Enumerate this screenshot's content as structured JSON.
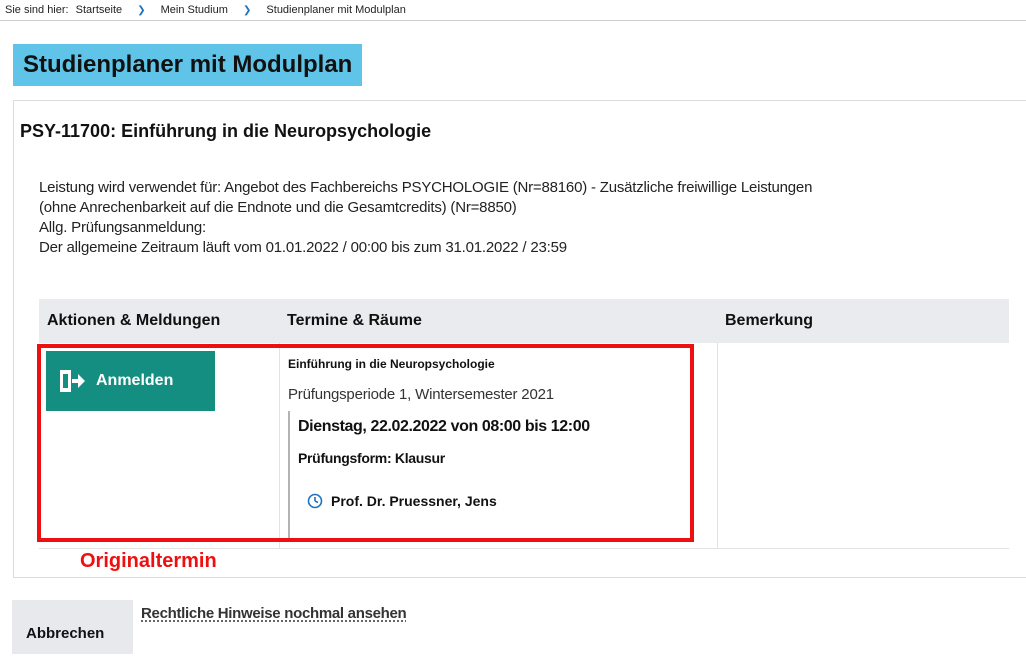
{
  "breadcrumb": {
    "prefix": "Sie sind hier:",
    "items": [
      "Startseite",
      "Mein Studium",
      "Studienplaner mit Modulplan"
    ]
  },
  "page": {
    "title": "Studienplaner mit Modulplan"
  },
  "module": {
    "heading": "PSY-11700: Einführung in die Neuropsychologie",
    "info_lines": [
      "Leistung wird verwendet für: Angebot des Fachbereichs PSYCHOLOGIE (Nr=88160) - Zusätzliche freiwillige Leistungen",
      "(ohne Anrechenbarkeit auf die Endnote und die Gesamtcredits) (Nr=8850)",
      "Allg. Prüfungsanmeldung:",
      "Der allgemeine Zeitraum läuft vom 01.01.2022 / 00:00 bis zum 31.01.2022 / 23:59"
    ]
  },
  "table": {
    "headers": [
      "Aktionen & Meldungen",
      "Termine & Räume",
      "Bemerkung"
    ],
    "row": {
      "action_label": "Anmelden",
      "exam_title": "Einführung in die Neuropsychologie",
      "period": "Prüfungsperiode 1, Wintersemester 2021",
      "date": "Dienstag, 22.02.2022 von 08:00 bis 12:00",
      "form": "Prüfungsform: Klausur",
      "examiner": "Prof. Dr. Pruessner, Jens",
      "remark": ""
    }
  },
  "annotation": {
    "label": "Originaltermin",
    "color": "#ee1010"
  },
  "footer": {
    "cancel_label": "Abbrechen",
    "legal_link": "Rechtliche Hinweise nochmal ansehen"
  },
  "colors": {
    "title_bg": "#5fc4e8",
    "button_bg": "#138e80",
    "link_accent": "#1e73be"
  },
  "icons": {
    "register": "door-enter-icon",
    "examiner": "clock-icon",
    "breadcrumb_separator": "chevron-right-icon"
  }
}
